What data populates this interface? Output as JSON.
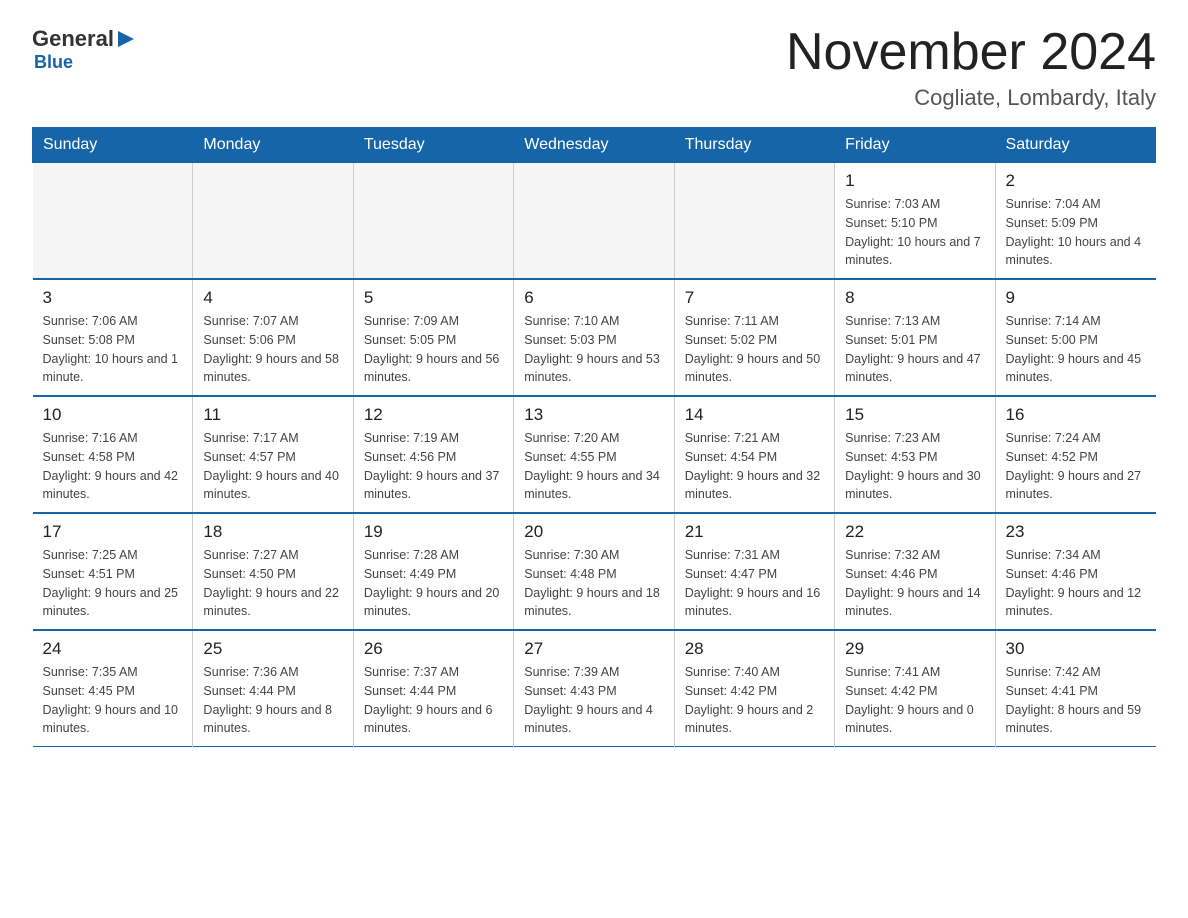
{
  "header": {
    "logo": {
      "general": "General",
      "blue": "Blue",
      "subtitle": "Blue"
    },
    "title": "November 2024",
    "location": "Cogliate, Lombardy, Italy"
  },
  "days_of_week": [
    "Sunday",
    "Monday",
    "Tuesday",
    "Wednesday",
    "Thursday",
    "Friday",
    "Saturday"
  ],
  "weeks": [
    [
      {
        "day": "",
        "info": ""
      },
      {
        "day": "",
        "info": ""
      },
      {
        "day": "",
        "info": ""
      },
      {
        "day": "",
        "info": ""
      },
      {
        "day": "",
        "info": ""
      },
      {
        "day": "1",
        "info": "Sunrise: 7:03 AM\nSunset: 5:10 PM\nDaylight: 10 hours and 7 minutes."
      },
      {
        "day": "2",
        "info": "Sunrise: 7:04 AM\nSunset: 5:09 PM\nDaylight: 10 hours and 4 minutes."
      }
    ],
    [
      {
        "day": "3",
        "info": "Sunrise: 7:06 AM\nSunset: 5:08 PM\nDaylight: 10 hours and 1 minute."
      },
      {
        "day": "4",
        "info": "Sunrise: 7:07 AM\nSunset: 5:06 PM\nDaylight: 9 hours and 58 minutes."
      },
      {
        "day": "5",
        "info": "Sunrise: 7:09 AM\nSunset: 5:05 PM\nDaylight: 9 hours and 56 minutes."
      },
      {
        "day": "6",
        "info": "Sunrise: 7:10 AM\nSunset: 5:03 PM\nDaylight: 9 hours and 53 minutes."
      },
      {
        "day": "7",
        "info": "Sunrise: 7:11 AM\nSunset: 5:02 PM\nDaylight: 9 hours and 50 minutes."
      },
      {
        "day": "8",
        "info": "Sunrise: 7:13 AM\nSunset: 5:01 PM\nDaylight: 9 hours and 47 minutes."
      },
      {
        "day": "9",
        "info": "Sunrise: 7:14 AM\nSunset: 5:00 PM\nDaylight: 9 hours and 45 minutes."
      }
    ],
    [
      {
        "day": "10",
        "info": "Sunrise: 7:16 AM\nSunset: 4:58 PM\nDaylight: 9 hours and 42 minutes."
      },
      {
        "day": "11",
        "info": "Sunrise: 7:17 AM\nSunset: 4:57 PM\nDaylight: 9 hours and 40 minutes."
      },
      {
        "day": "12",
        "info": "Sunrise: 7:19 AM\nSunset: 4:56 PM\nDaylight: 9 hours and 37 minutes."
      },
      {
        "day": "13",
        "info": "Sunrise: 7:20 AM\nSunset: 4:55 PM\nDaylight: 9 hours and 34 minutes."
      },
      {
        "day": "14",
        "info": "Sunrise: 7:21 AM\nSunset: 4:54 PM\nDaylight: 9 hours and 32 minutes."
      },
      {
        "day": "15",
        "info": "Sunrise: 7:23 AM\nSunset: 4:53 PM\nDaylight: 9 hours and 30 minutes."
      },
      {
        "day": "16",
        "info": "Sunrise: 7:24 AM\nSunset: 4:52 PM\nDaylight: 9 hours and 27 minutes."
      }
    ],
    [
      {
        "day": "17",
        "info": "Sunrise: 7:25 AM\nSunset: 4:51 PM\nDaylight: 9 hours and 25 minutes."
      },
      {
        "day": "18",
        "info": "Sunrise: 7:27 AM\nSunset: 4:50 PM\nDaylight: 9 hours and 22 minutes."
      },
      {
        "day": "19",
        "info": "Sunrise: 7:28 AM\nSunset: 4:49 PM\nDaylight: 9 hours and 20 minutes."
      },
      {
        "day": "20",
        "info": "Sunrise: 7:30 AM\nSunset: 4:48 PM\nDaylight: 9 hours and 18 minutes."
      },
      {
        "day": "21",
        "info": "Sunrise: 7:31 AM\nSunset: 4:47 PM\nDaylight: 9 hours and 16 minutes."
      },
      {
        "day": "22",
        "info": "Sunrise: 7:32 AM\nSunset: 4:46 PM\nDaylight: 9 hours and 14 minutes."
      },
      {
        "day": "23",
        "info": "Sunrise: 7:34 AM\nSunset: 4:46 PM\nDaylight: 9 hours and 12 minutes."
      }
    ],
    [
      {
        "day": "24",
        "info": "Sunrise: 7:35 AM\nSunset: 4:45 PM\nDaylight: 9 hours and 10 minutes."
      },
      {
        "day": "25",
        "info": "Sunrise: 7:36 AM\nSunset: 4:44 PM\nDaylight: 9 hours and 8 minutes."
      },
      {
        "day": "26",
        "info": "Sunrise: 7:37 AM\nSunset: 4:44 PM\nDaylight: 9 hours and 6 minutes."
      },
      {
        "day": "27",
        "info": "Sunrise: 7:39 AM\nSunset: 4:43 PM\nDaylight: 9 hours and 4 minutes."
      },
      {
        "day": "28",
        "info": "Sunrise: 7:40 AM\nSunset: 4:42 PM\nDaylight: 9 hours and 2 minutes."
      },
      {
        "day": "29",
        "info": "Sunrise: 7:41 AM\nSunset: 4:42 PM\nDaylight: 9 hours and 0 minutes."
      },
      {
        "day": "30",
        "info": "Sunrise: 7:42 AM\nSunset: 4:41 PM\nDaylight: 8 hours and 59 minutes."
      }
    ]
  ]
}
